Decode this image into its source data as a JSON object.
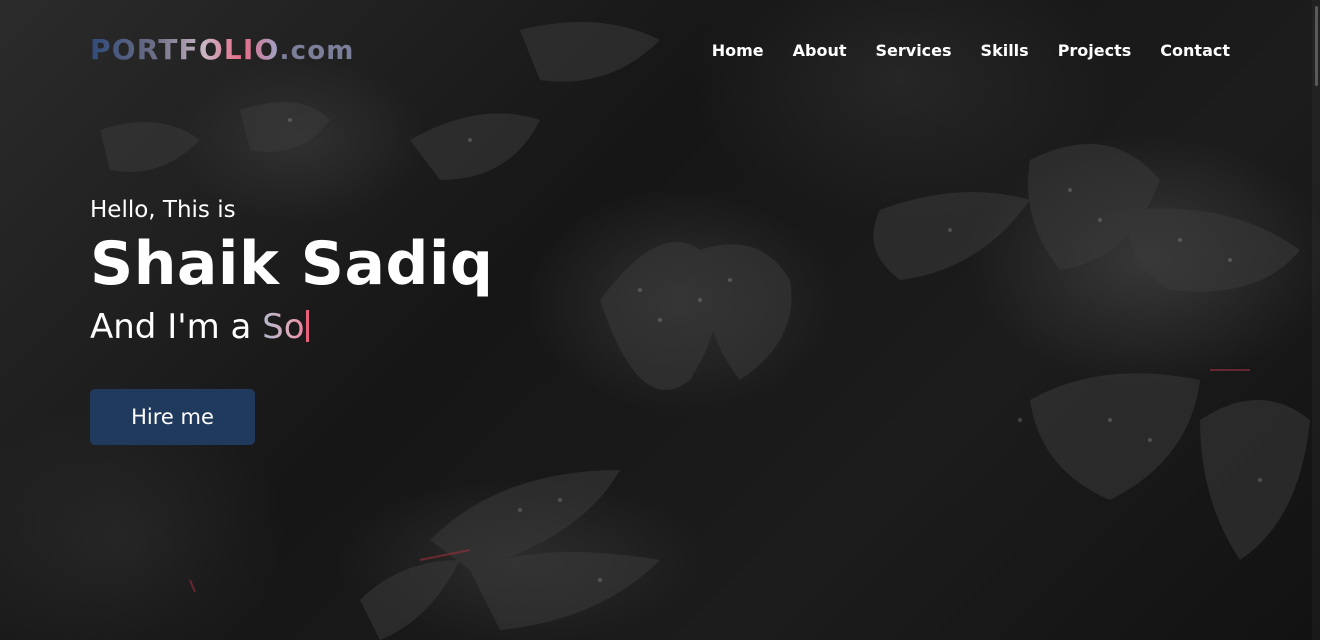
{
  "nav": {
    "logo_main": "PORTFOLIO",
    "logo_suffix": ".com",
    "links": [
      "Home",
      "About",
      "Services",
      "Skills",
      "Projects",
      "Contact"
    ]
  },
  "hero": {
    "greeting": "Hello, This is",
    "name": "Shaik Sadiq",
    "role_prefix": "And I'm a ",
    "role_typed": "So",
    "button_label": "Hire me",
    "background_icon": "dark-leaves-rain-photo"
  },
  "colors": {
    "button_bg": "#203a5e",
    "cursor": "#e8607a",
    "logo_gradient_start": "#2f4b7c",
    "logo_gradient_end": "#e86b88"
  }
}
